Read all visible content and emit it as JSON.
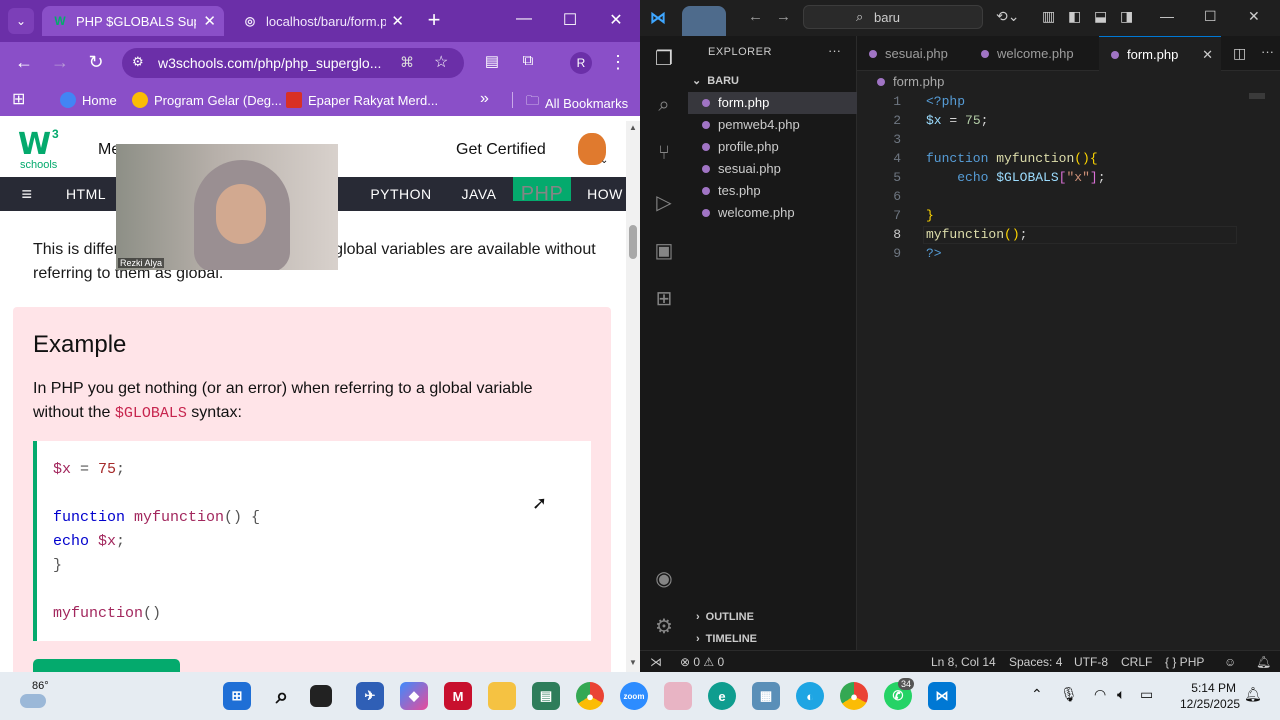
{
  "browser": {
    "tabs": [
      {
        "title": "PHP $GLOBALS Superg",
        "active": true
      },
      {
        "title": "localhost/baru/form.p",
        "active": false
      }
    ],
    "new_tab": "+",
    "url": "w3schools.com/php/php_superglo...",
    "profile_initial": "R",
    "bookmarks": [
      {
        "label": "Home",
        "color": "#4285f4"
      },
      {
        "label": "Program Gelar (Deg...",
        "color": "#fbbc05"
      },
      {
        "label": "Epaper Rakyat Merd...",
        "color": "#d93025"
      }
    ],
    "bookmarks_more": "»",
    "all_bookmarks": "All Bookmarks"
  },
  "w3": {
    "logo_text": "schools",
    "logo_sup": "3",
    "menu_partial": "Me",
    "get_certified": "Get Certified",
    "nav": [
      "HTML",
      "PYTHON",
      "JAVA",
      "PHP",
      "HOW"
    ],
    "nav_active": "PHP",
    "intro": "This is differ                    languages where global variables are available without referring to them as global.",
    "example_title": "Example",
    "example_desc_1": "In PHP you get nothing (or an error) when referring to a global variable without the ",
    "example_desc_code": "$GLOBALS",
    "example_desc_2": " syntax:",
    "code_lines": [
      "$x = 75;",
      "function myfunction() {",
      "  echo $x;",
      "}",
      "myfunction()"
    ],
    "webcam_name": "Rezki Alya"
  },
  "vscode": {
    "search": "baru",
    "explorer_title": "EXPLORER",
    "folder": "BARU",
    "files": [
      "form.php",
      "pemweb4.php",
      "profile.php",
      "sesuai.php",
      "tes.php",
      "welcome.php"
    ],
    "selected_file": "form.php",
    "tabs": [
      "sesuai.php",
      "welcome.php",
      "form.php"
    ],
    "active_tab": "form.php",
    "breadcrumb": "form.php",
    "line_numbers": [
      "1",
      "2",
      "3",
      "4",
      "5",
      "6",
      "7",
      "8",
      "9"
    ],
    "outline": "OUTLINE",
    "timeline": "TIMELINE",
    "status": {
      "problems": "⊗ 0 ⚠ 0",
      "position": "Ln 8, Col 14",
      "spaces": "Spaces: 4",
      "encoding": "UTF-8",
      "eol": "CRLF",
      "language": "{ } PHP"
    }
  },
  "taskbar": {
    "weather": "86°",
    "time": "5:14 PM",
    "date": "12/25/2025",
    "whatsapp_badge": "34"
  },
  "colors": {
    "browser_theme": "#8a4fc8",
    "w3_green": "#04aa6d",
    "w3_nav": "#282a35",
    "example_bg": "#ffe4e8",
    "vscode_bg": "#1f1f1f"
  }
}
